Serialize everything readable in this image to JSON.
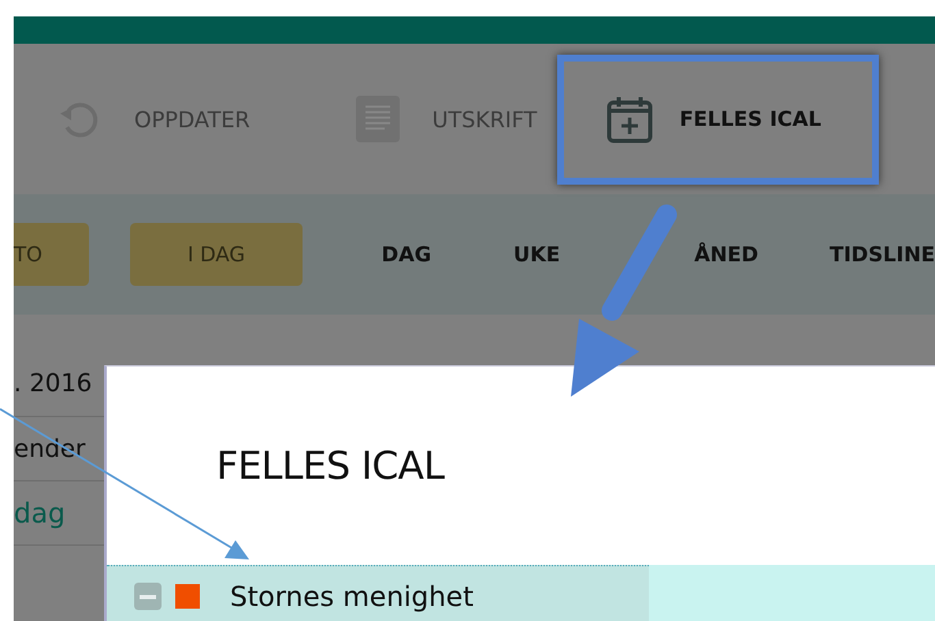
{
  "toolbar": [
    {
      "label": "OPPDATER",
      "disabled": true
    },
    {
      "label": "UTSKRIFT",
      "disabled": true
    },
    {
      "label": "FELLES ICAL",
      "disabled": false
    }
  ],
  "nav": [
    {
      "label": "TO",
      "kind": "button"
    },
    {
      "label": "I DAG",
      "kind": "button"
    },
    {
      "label": "DAG",
      "kind": "tab"
    },
    {
      "label": "UKE",
      "kind": "tab"
    },
    {
      "label": "ÅNED",
      "kind": "tab"
    },
    {
      "label": "TIDSLINE",
      "kind": "tab"
    }
  ],
  "content": [
    {
      "text": ". 2016",
      "kind": "text"
    },
    {
      "text": "ender",
      "kind": "text"
    },
    {
      "text": "dag",
      "kind": "link"
    }
  ],
  "dialog": {
    "title": "FELLES ICAL",
    "calendars": [
      {
        "label": "Stornes menighet",
        "color": "#f04e00",
        "expanded": true,
        "selected": true
      }
    ]
  }
}
